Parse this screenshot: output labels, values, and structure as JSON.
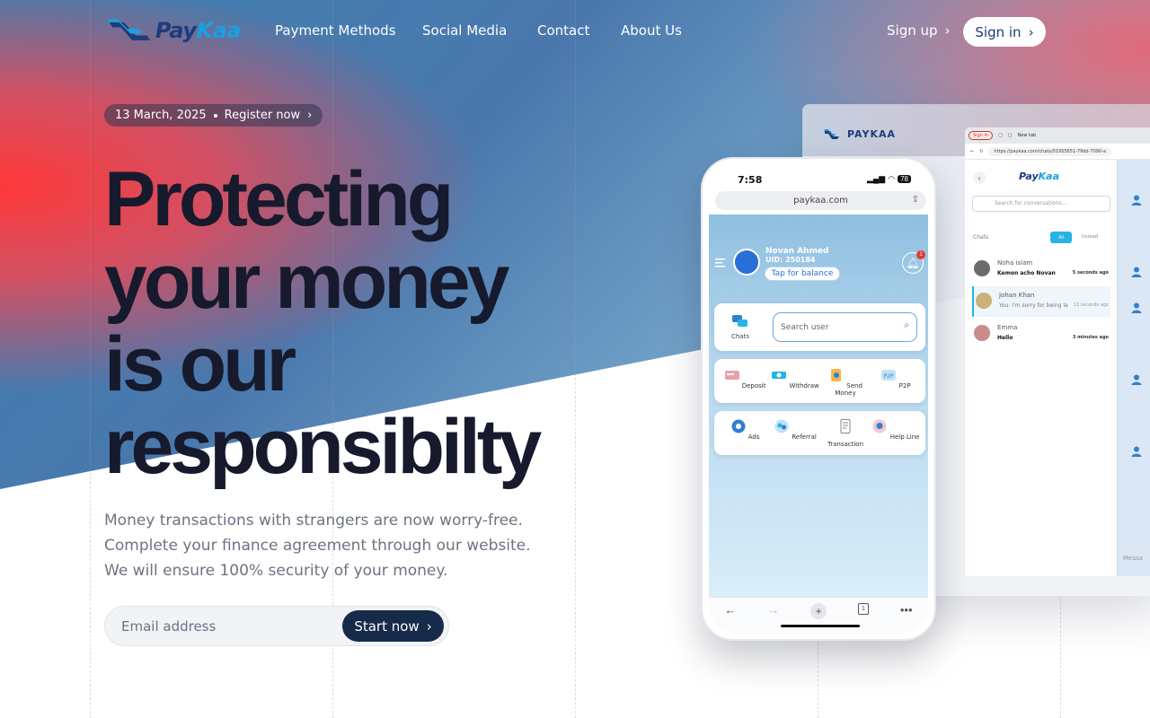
{
  "brand": {
    "name_a": "Pay",
    "name_b": "Kaa",
    "desktop_label": "PAYKAA"
  },
  "nav": {
    "links": [
      "Payment Methods",
      "Social Media",
      "Contact",
      "About Us"
    ],
    "signup": "Sign up",
    "signin": "Sign in"
  },
  "announcement": {
    "date": "13 March, 2025",
    "cta": "Register now"
  },
  "hero": {
    "lines": [
      "Protecting",
      "your money",
      "is our",
      "responsibilty"
    ],
    "subtext": "Money transactions with strangers are now worry-free. Complete your finance agreement through our website. We will ensure 100% security of your money.",
    "email_placeholder": "Email address",
    "start_label": "Start now"
  },
  "colors": {
    "accent_red": "#ff3b3b",
    "accent_blue": "#4a7fb3",
    "dark_navy": "#162a4a",
    "brand_light": "#1a9fe0"
  },
  "phone": {
    "time": "7:58",
    "battery": "78",
    "url": "paykaa.com",
    "user_name": "Novan Ahmed",
    "uid": "UID: 250184",
    "balance_btn": "Tap for balance",
    "notifications": "1",
    "chats_label": "Chats",
    "search_placeholder": "Search user",
    "actions_row1": [
      "Deposit",
      "Withdraw",
      "Send Money",
      "P2P"
    ],
    "actions_row2": [
      "Ads",
      "Referral",
      "Transaction",
      "Help Line"
    ],
    "tabs_count": "1"
  },
  "desktop_browser": {
    "tab_signin": "Sign in",
    "tab_new": "New tab",
    "url": "https://paykaa.com/chats/01955651-79dd-7090-a",
    "search_placeholder": "Search for conversations...",
    "chats_label": "Chats",
    "filter_all": "All",
    "filter_unread": "Unread",
    "conversations": [
      {
        "name": "Noha islam",
        "message": "Kemon acho Novan",
        "time": "5 seconds ago"
      },
      {
        "name": "Johan Khan",
        "message": "You: I'm sorry for being la",
        "time": "13 seconds ago"
      },
      {
        "name": "Emma",
        "message": "Hello",
        "time": "3 minutes ago"
      }
    ],
    "message_placeholder": "Messa"
  }
}
